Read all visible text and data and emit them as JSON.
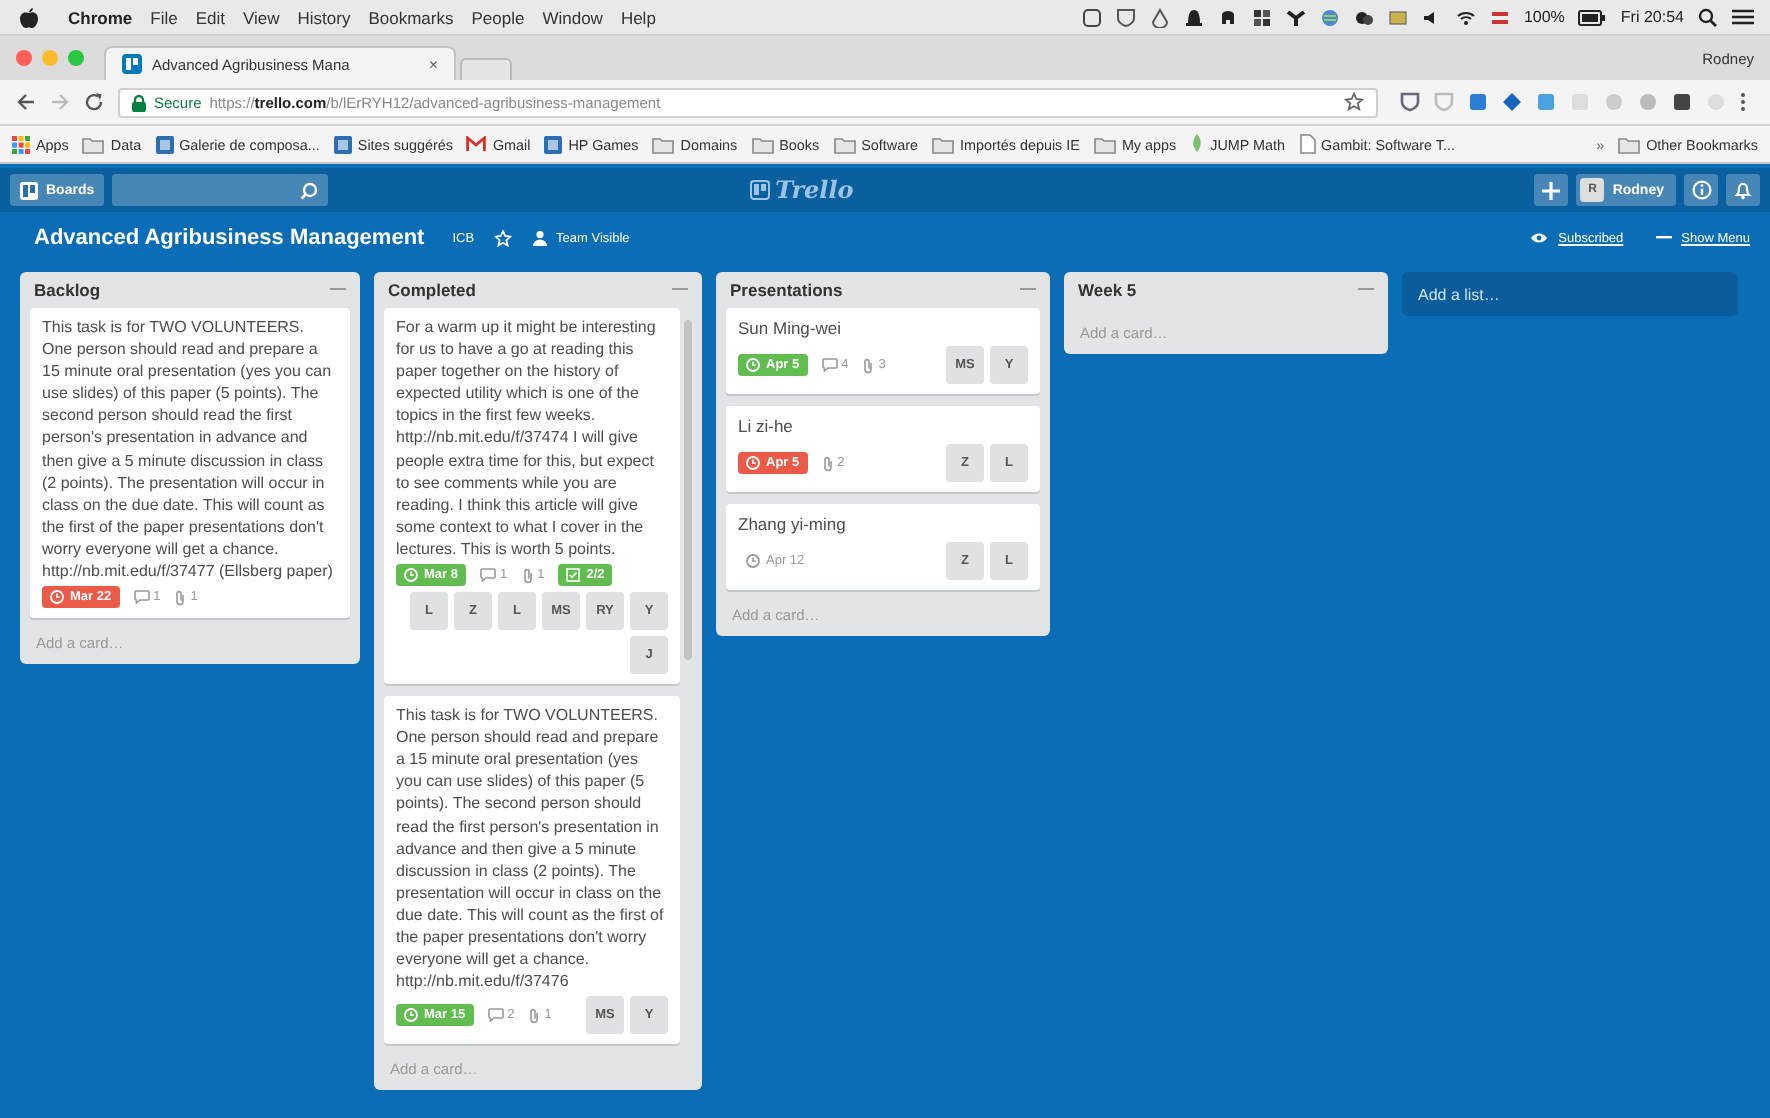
{
  "menu_bar": {
    "app": "Chrome",
    "items": [
      "File",
      "Edit",
      "View",
      "History",
      "Bookmarks",
      "People",
      "Window",
      "Help"
    ],
    "battery": "100%",
    "clock": "Fri 20:54"
  },
  "browser": {
    "tab": {
      "title": "Advanced Agribusiness Mana",
      "close": "×"
    },
    "profile": "Rodney",
    "address": {
      "secure_label": "Secure",
      "url": "https://**trello.com**/b/lErRYH12/advanced-agribusiness-management"
    },
    "bookmarks": [
      {
        "label": "Apps",
        "kind": "apps"
      },
      {
        "label": "Data",
        "kind": "folder"
      },
      {
        "label": "Galerie de composa...",
        "kind": "site"
      },
      {
        "label": "Sites suggérés",
        "kind": "site"
      },
      {
        "label": "Gmail",
        "kind": "mail"
      },
      {
        "label": "HP Games",
        "kind": "site"
      },
      {
        "label": "Domains",
        "kind": "folder"
      },
      {
        "label": "Books",
        "kind": "folder"
      },
      {
        "label": "Software",
        "kind": "folder"
      },
      {
        "label": "Importés depuis IE",
        "kind": "folder"
      },
      {
        "label": "My apps",
        "kind": "folder"
      },
      {
        "label": "JUMP Math",
        "kind": "leaf"
      },
      {
        "label": "Gambit: Software T...",
        "kind": "page"
      },
      {
        "label": "»",
        "kind": "more"
      },
      {
        "label": "Other Bookmarks",
        "kind": "folder"
      }
    ]
  },
  "trello_header": {
    "boards_button": "Boards",
    "logo": "Trello",
    "user": {
      "initial": "R",
      "name": "Rodney"
    }
  },
  "board": {
    "title": "Advanced Agribusiness Management",
    "org": "ICB",
    "visibility": "Team Visible",
    "subscribed": "Subscribed",
    "show_menu": "Show Menu",
    "add_list": "Add a list…",
    "lists": [
      {
        "name": "Backlog",
        "scrollbar": false,
        "add_card": "Add a card…",
        "cards": [
          {
            "text": "This task is for TWO VOLUNTEERS. One person should read and prepare a 15 minute oral presentation (yes you can use slides) of this paper (5 points). The second person should read the first person's presentation in advance and then give a 5 minute discussion in class (2 points). The presentation will occur in class on the due date. This will count as the first of the paper presentations don't worry everyone will get a chance. http://nb.mit.edu/f/37477 (Ellsberg paper)",
            "due": {
              "label": "Mar 22",
              "complete": false,
              "overdue": true
            },
            "comments": "1",
            "attachments": "1"
          }
        ]
      },
      {
        "name": "Completed",
        "scrollbar": true,
        "add_card": "Add a card…",
        "cards": [
          {
            "text": "For a warm up it might be interesting for us to have a go at reading this paper together on the history of expected utility which is one of the topics in the first few weeks. http://nb.mit.edu/f/37474 I will give people extra time for this, but expect to see comments while you are reading. I think this article will give some context to what I cover in the lectures. This is worth 5 points.",
            "due": {
              "label": "Mar 8",
              "complete": true,
              "overdue": false
            },
            "comments": "1",
            "attachments": "1",
            "checklist": {
              "label": "2/2",
              "complete": true
            },
            "members": [
              "L",
              "Z",
              "L",
              "MS",
              "RY",
              "Y",
              "J"
            ]
          },
          {
            "text": "This task is for TWO VOLUNTEERS. One person should read and prepare a 15 minute oral presentation (yes you can use slides) of this paper (5 points). The second person should read the first person's presentation in advance and then give a 5 minute discussion in class (2 points). The presentation will occur in class on the due date. This will count as the first of the paper presentations don't worry everyone will get a chance. http://nb.mit.edu/f/37476",
            "due": {
              "label": "Mar 15",
              "complete": true,
              "overdue": false
            },
            "comments": "2",
            "attachments": "1",
            "members": [
              "MS",
              "Y"
            ]
          }
        ]
      },
      {
        "name": "Presentations",
        "scrollbar": false,
        "add_card": "Add a card…",
        "cards": [
          {
            "text": "Sun Ming-wei",
            "due": {
              "label": "Apr 5",
              "complete": true,
              "overdue": false
            },
            "comments": "4",
            "attachments": "3",
            "members": [
              "MS",
              "Y"
            ]
          },
          {
            "text": "Li zi-he",
            "due": {
              "label": "Apr 5",
              "complete": false,
              "overdue": true
            },
            "attachments": "2",
            "members": [
              "Z",
              "L"
            ]
          },
          {
            "text": "Zhang yi-ming",
            "due": {
              "label": "Apr 12",
              "complete": false,
              "overdue": false
            },
            "members": [
              "Z",
              "L"
            ]
          }
        ]
      },
      {
        "name": "Week 5",
        "scrollbar": false,
        "add_card": "Add a card…"
      }
    ]
  }
}
